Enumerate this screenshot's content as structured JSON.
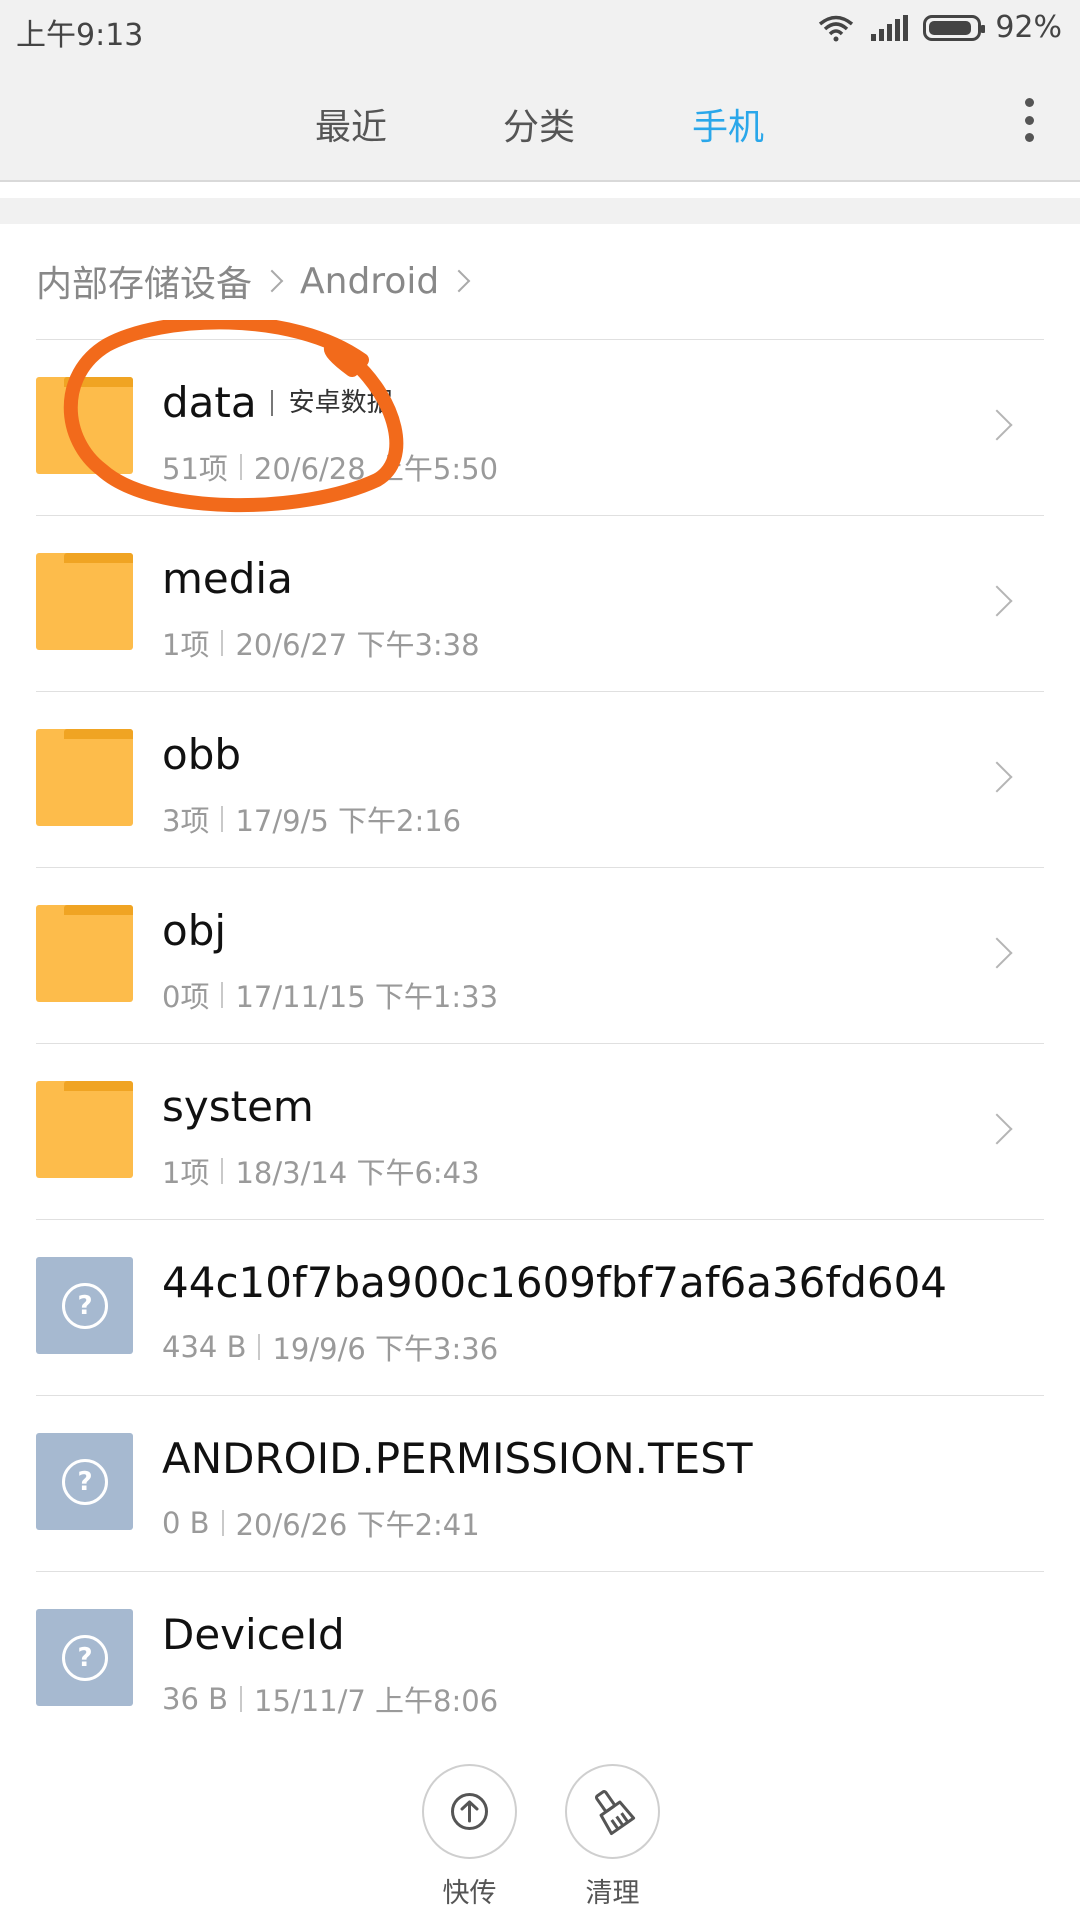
{
  "status": {
    "time": "上午9:13",
    "battery": "92%"
  },
  "tabs": [
    {
      "label": "最近",
      "active": false
    },
    {
      "label": "分类",
      "active": false
    },
    {
      "label": "手机",
      "active": true
    }
  ],
  "breadcrumb": {
    "root": "内部存储设备",
    "current": "Android"
  },
  "files": [
    {
      "name": "data",
      "tag": "安卓数据",
      "count": "51项",
      "date": "20/6/28 上午5:50",
      "type": "folder"
    },
    {
      "name": "media",
      "count": "1项",
      "date": "20/6/27 下午3:38",
      "type": "folder"
    },
    {
      "name": "obb",
      "count": "3项",
      "date": "17/9/5 下午2:16",
      "type": "folder"
    },
    {
      "name": "obj",
      "count": "0项",
      "date": "17/11/15 下午1:33",
      "type": "folder"
    },
    {
      "name": "system",
      "count": "1项",
      "date": "18/3/14 下午6:43",
      "type": "folder"
    },
    {
      "name": "44c10f7ba900c1609fbf7af6a36fd604",
      "count": "434 B",
      "date": "19/9/6 下午3:36",
      "type": "unknown"
    },
    {
      "name": "ANDROID.PERMISSION.TEST",
      "count": "0 B",
      "date": "20/6/26 下午2:41",
      "type": "unknown"
    },
    {
      "name": "DeviceId",
      "count": "36 B",
      "date": "15/11/7 上午8:06",
      "type": "unknown"
    }
  ],
  "actions": {
    "share": "快传",
    "clean": "清理"
  },
  "colors": {
    "accent": "#2aa7ea",
    "folder": "#fdbc4b",
    "unknown_file": "#a6b9d0",
    "annotation": "#f26a1b"
  },
  "unknown_icon_glyph": "?"
}
